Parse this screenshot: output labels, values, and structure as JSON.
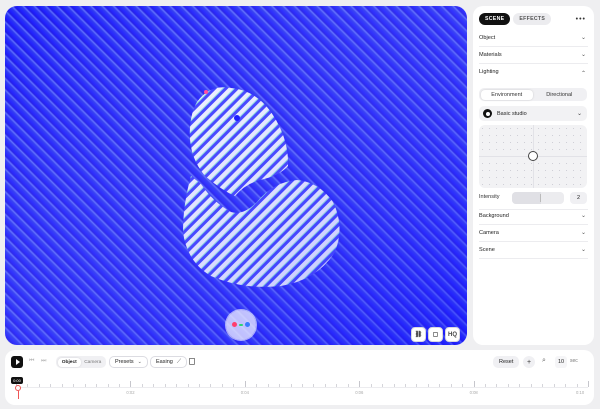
{
  "viewport": {
    "background_color": "#1d1dff",
    "overlay_buttons": [
      {
        "name": "link-icon",
        "glyph": "⛓"
      },
      {
        "name": "frame-icon",
        "glyph": "▢"
      },
      {
        "name": "hq-button",
        "label": "HQ"
      }
    ],
    "gizmo_colors": [
      "#ff3d6e",
      "#2bd672",
      "#3a7bff"
    ]
  },
  "panel": {
    "tabs": [
      {
        "label": "SCENE",
        "active": true
      },
      {
        "label": "EFFECTS",
        "active": false
      }
    ],
    "more_icon": "ellipsis-icon",
    "sections_top": [
      "Object",
      "Materials",
      "Lighting"
    ],
    "lighting": {
      "mode_options": [
        "Environment",
        "Directional"
      ],
      "selected_mode": "Environment",
      "environment_preset": "Basic studio",
      "intensity_label": "Intensity",
      "intensity_value": "2",
      "intensity_fraction": 0.56
    },
    "sections_bottom": [
      "Background",
      "Camera",
      "Scene"
    ]
  },
  "timeline": {
    "play_icon": "play-icon",
    "prev_icon": "skip-back-icon",
    "next_icon": "skip-forward-icon",
    "target_options": [
      "Object",
      "Camera"
    ],
    "selected_target": "Object",
    "presets_label": "Presets",
    "easing_label": "Easing",
    "reset_label": "Reset",
    "add_label": "+",
    "zoom_icon": "zoom-icon",
    "duration_value": "10",
    "duration_unit": "sec",
    "playhead_label": "0:00",
    "tick_labels": [
      "0:02",
      "0:04",
      "0:06",
      "0:08",
      "0:10"
    ]
  }
}
